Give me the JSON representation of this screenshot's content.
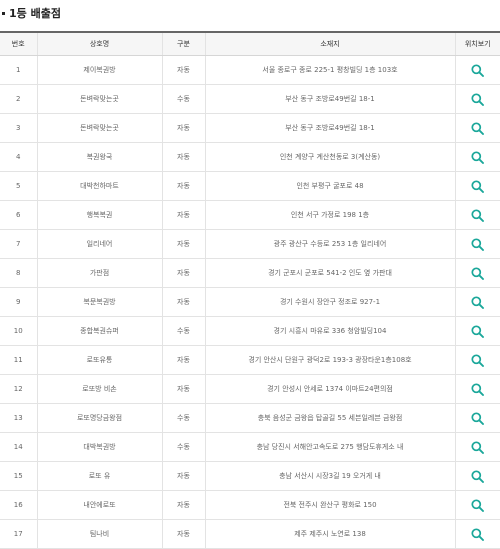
{
  "section_title": "1등 배출점",
  "headers": {
    "no": "번호",
    "name": "상호명",
    "type": "구분",
    "address": "소재지",
    "map": "위치보기"
  },
  "accent_color": "#1aa79a",
  "rows": [
    {
      "no": "1",
      "name": "제이복권방",
      "type": "자동",
      "address": "서울 종로구 종로 225-1 평창빌딩 1층 103호"
    },
    {
      "no": "2",
      "name": "돈벼락맞는곳",
      "type": "수동",
      "address": "부산 동구 조방로49번길 18-1"
    },
    {
      "no": "3",
      "name": "돈벼락맞는곳",
      "type": "자동",
      "address": "부산 동구 조방로49번길 18-1"
    },
    {
      "no": "4",
      "name": "복권왕국",
      "type": "자동",
      "address": "인천 계양구 계산천동로 3(계산동)"
    },
    {
      "no": "5",
      "name": "대박천하마트",
      "type": "자동",
      "address": "인천 부평구 굴포로 48"
    },
    {
      "no": "6",
      "name": "행복복권",
      "type": "자동",
      "address": "인천 서구 가정로 198 1층"
    },
    {
      "no": "7",
      "name": "일리네어",
      "type": "자동",
      "address": "광주 광산구 수등로 253 1층 일리네어"
    },
    {
      "no": "8",
      "name": "가판점",
      "type": "자동",
      "address": "경기 군포시 군포로 541-2 인도 옆 가판대"
    },
    {
      "no": "9",
      "name": "복문복권방",
      "type": "자동",
      "address": "경기 수원시 장안구 정조로 927-1"
    },
    {
      "no": "10",
      "name": "종합복권슈퍼",
      "type": "수동",
      "address": "경기 시흥시 마유로 336 청암빌딩104"
    },
    {
      "no": "11",
      "name": "로또유통",
      "type": "자동",
      "address": "경기 안산시 단원구 광덕2로 193-3 광장타운1층108호"
    },
    {
      "no": "12",
      "name": "로또방 비손",
      "type": "자동",
      "address": "경기 안성시 안세로 1374 이마트24편의점"
    },
    {
      "no": "13",
      "name": "로또명당금왕점",
      "type": "수동",
      "address": "충북 음성군 금왕읍 탑골길 55 세븐일레븐 금왕점"
    },
    {
      "no": "14",
      "name": "대박복권방",
      "type": "수동",
      "address": "충남 당진시 서해안고속도로 275 행담도휴게소 내"
    },
    {
      "no": "15",
      "name": "로또 유",
      "type": "자동",
      "address": "충남 서산시 시장3길 19 오거게 내"
    },
    {
      "no": "16",
      "name": "내안에로또",
      "type": "자동",
      "address": "전북 전주시 완산구 평화로 150"
    },
    {
      "no": "17",
      "name": "팀나비",
      "type": "자동",
      "address": "제주 제주시 노연로 138"
    }
  ]
}
